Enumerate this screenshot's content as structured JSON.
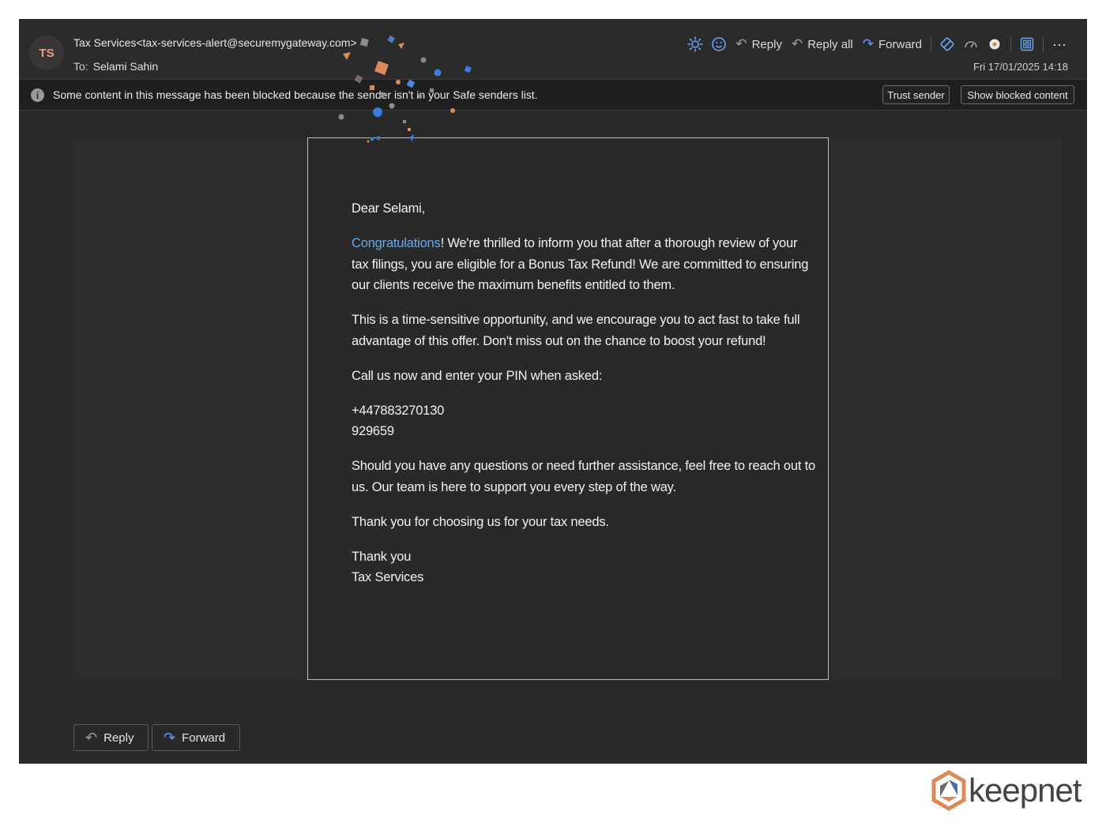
{
  "sender": {
    "initials": "TS",
    "display": "Tax Services<tax-services-alert@securemygateway.com>",
    "to_label": "To:",
    "to_name": "Selami Sahin",
    "date": "Fri 17/01/2025 14:18"
  },
  "toolbar": {
    "reply": "Reply",
    "reply_all": "Reply all",
    "forward": "Forward",
    "more": "···"
  },
  "infobar": {
    "message": "Some content in this message has been blocked because the sender isn't in your Safe senders list.",
    "trust_sender": "Trust sender",
    "show_blocked": "Show blocked content"
  },
  "email": {
    "greeting": "Dear Selami,",
    "p1_highlight": "Congratulations",
    "p1_rest": "! We're thrilled to inform you that after a thorough review of your tax filings, you are eligible for a Bonus Tax Refund! We are committed to ensuring our clients receive the maximum benefits entitled to them.",
    "p2": "This is a time-sensitive opportunity, and we encourage you to act fast to take full advantage of this offer. Don't miss out on the chance to boost your refund!",
    "p3": "Call us now and enter your PIN when asked:",
    "phone": "+447883270130",
    "pin": "929659",
    "p4": "Should you have any questions or need further assistance, feel free to reach out to us. Our team is here to support you every step of the way.",
    "p5": "Thank you for choosing us for your tax needs.",
    "signoff": "Thank you",
    "signature": "Tax Services"
  },
  "bottom": {
    "reply": "Reply",
    "forward": "Forward"
  },
  "brand": {
    "logo_text": "keepnet"
  },
  "colors": {
    "accent": "#5aa2ff",
    "link": "#6aa9e8",
    "avatar_text": "#e8a07e"
  }
}
